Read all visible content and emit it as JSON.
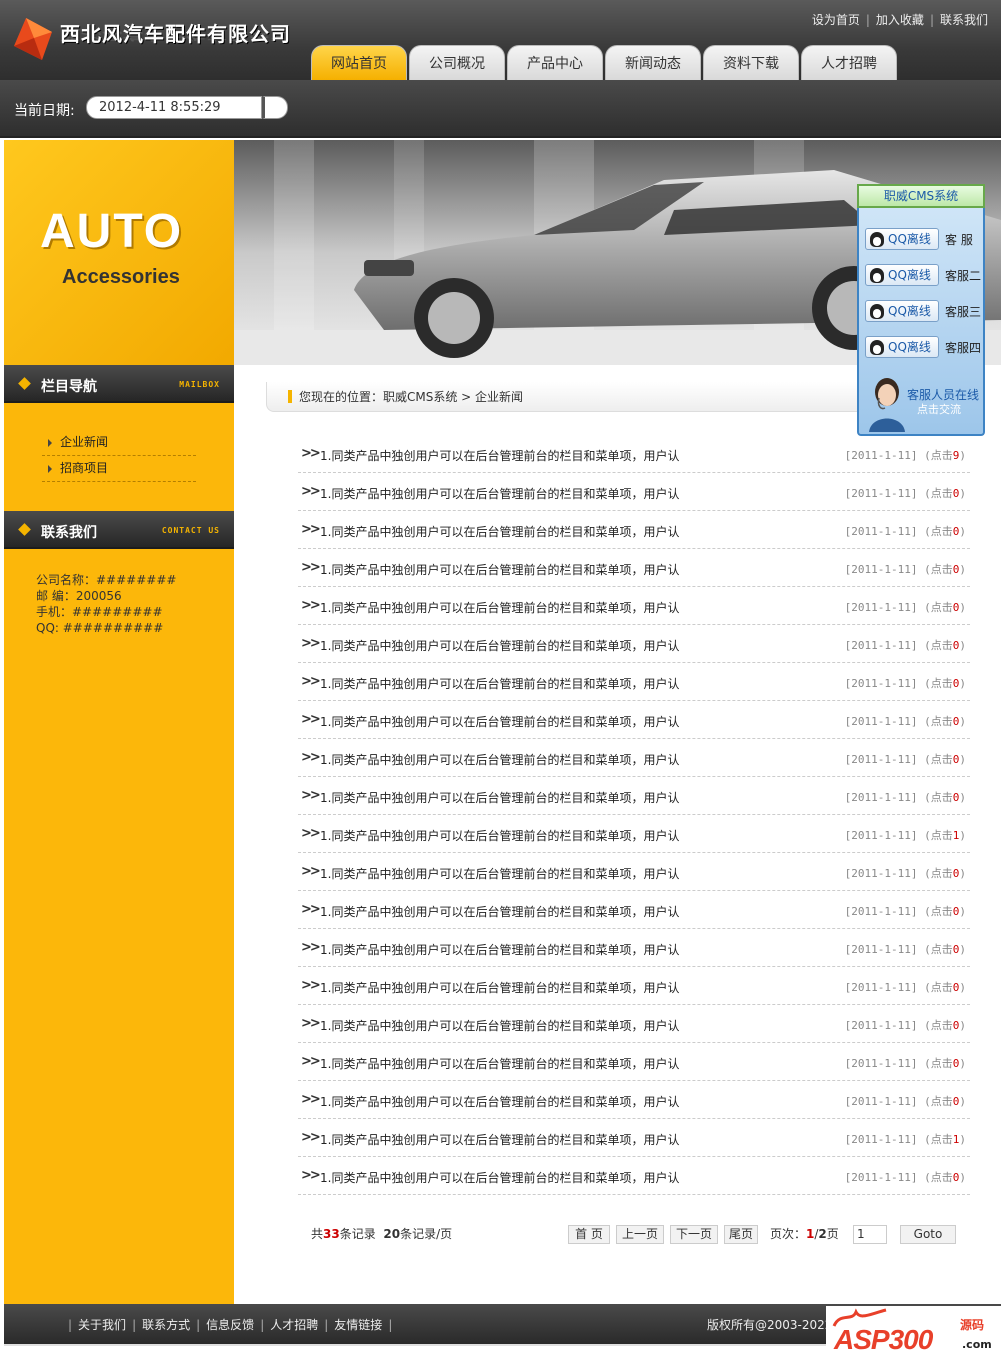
{
  "header": {
    "site_title": "西北风汽车配件有限公司",
    "top_links": [
      "设为首页",
      "加入收藏",
      "联系我们"
    ],
    "nav": [
      {
        "label": "网站首页",
        "active": true
      },
      {
        "label": "公司概况",
        "active": false
      },
      {
        "label": "产品中心",
        "active": false
      },
      {
        "label": "新闻动态",
        "active": false
      },
      {
        "label": "资料下载",
        "active": false
      },
      {
        "label": "人才招聘",
        "active": false
      }
    ]
  },
  "datebar": {
    "label": "当前日期:",
    "value": "2012-4-11 8:55:29"
  },
  "banner": {
    "auto": "AUTO",
    "accessories": "Accessories"
  },
  "sidebar": {
    "nav_title": "栏目导航",
    "nav_sub": "MAILBOX",
    "items": [
      "企业新闻",
      "招商项目"
    ],
    "contact_title": "联系我们",
    "contact_sub": "CONTACT US",
    "contact_lines": [
      "公司名称：########",
      "邮 编：200056",
      "手机：#########",
      "QQ: ##########"
    ]
  },
  "breadcrumb": {
    "text": "您现在的位置：职威CMS系统 > 企业新闻"
  },
  "news": [
    {
      "title": "1.同类产品中独创用户可以在后台管理前台的栏目和菜单项，用户认",
      "date": "2011-1-11",
      "clicks_label": "点击",
      "clicks": "9"
    },
    {
      "title": "1.同类产品中独创用户可以在后台管理前台的栏目和菜单项，用户认",
      "date": "2011-1-11",
      "clicks_label": "点击",
      "clicks": "0"
    },
    {
      "title": "1.同类产品中独创用户可以在后台管理前台的栏目和菜单项，用户认",
      "date": "2011-1-11",
      "clicks_label": "点击",
      "clicks": "0"
    },
    {
      "title": "1.同类产品中独创用户可以在后台管理前台的栏目和菜单项，用户认",
      "date": "2011-1-11",
      "clicks_label": "点击",
      "clicks": "0"
    },
    {
      "title": "1.同类产品中独创用户可以在后台管理前台的栏目和菜单项，用户认",
      "date": "2011-1-11",
      "clicks_label": "点击",
      "clicks": "0"
    },
    {
      "title": "1.同类产品中独创用户可以在后台管理前台的栏目和菜单项，用户认",
      "date": "2011-1-11",
      "clicks_label": "点击",
      "clicks": "0"
    },
    {
      "title": "1.同类产品中独创用户可以在后台管理前台的栏目和菜单项，用户认",
      "date": "2011-1-11",
      "clicks_label": "点击",
      "clicks": "0"
    },
    {
      "title": "1.同类产品中独创用户可以在后台管理前台的栏目和菜单项，用户认",
      "date": "2011-1-11",
      "clicks_label": "点击",
      "clicks": "0"
    },
    {
      "title": "1.同类产品中独创用户可以在后台管理前台的栏目和菜单项，用户认",
      "date": "2011-1-11",
      "clicks_label": "点击",
      "clicks": "0"
    },
    {
      "title": "1.同类产品中独创用户可以在后台管理前台的栏目和菜单项，用户认",
      "date": "2011-1-11",
      "clicks_label": "点击",
      "clicks": "0"
    },
    {
      "title": "1.同类产品中独创用户可以在后台管理前台的栏目和菜单项，用户认",
      "date": "2011-1-11",
      "clicks_label": "点击",
      "clicks": "1"
    },
    {
      "title": "1.同类产品中独创用户可以在后台管理前台的栏目和菜单项，用户认",
      "date": "2011-1-11",
      "clicks_label": "点击",
      "clicks": "0"
    },
    {
      "title": "1.同类产品中独创用户可以在后台管理前台的栏目和菜单项，用户认",
      "date": "2011-1-11",
      "clicks_label": "点击",
      "clicks": "0"
    },
    {
      "title": "1.同类产品中独创用户可以在后台管理前台的栏目和菜单项，用户认",
      "date": "2011-1-11",
      "clicks_label": "点击",
      "clicks": "0"
    },
    {
      "title": "1.同类产品中独创用户可以在后台管理前台的栏目和菜单项，用户认",
      "date": "2011-1-11",
      "clicks_label": "点击",
      "clicks": "0"
    },
    {
      "title": "1.同类产品中独创用户可以在后台管理前台的栏目和菜单项，用户认",
      "date": "2011-1-11",
      "clicks_label": "点击",
      "clicks": "0"
    },
    {
      "title": "1.同类产品中独创用户可以在后台管理前台的栏目和菜单项，用户认",
      "date": "2011-1-11",
      "clicks_label": "点击",
      "clicks": "0"
    },
    {
      "title": "1.同类产品中独创用户可以在后台管理前台的栏目和菜单项，用户认",
      "date": "2011-1-11",
      "clicks_label": "点击",
      "clicks": "0"
    },
    {
      "title": "1.同类产品中独创用户可以在后台管理前台的栏目和菜单项，用户认",
      "date": "2011-1-11",
      "clicks_label": "点击",
      "clicks": "1"
    },
    {
      "title": "1.同类产品中独创用户可以在后台管理前台的栏目和菜单项，用户认",
      "date": "2011-1-11",
      "clicks_label": "点击",
      "clicks": "0"
    }
  ],
  "pager": {
    "total_prefix": "共",
    "total": "33",
    "total_suffix": "条记录",
    "per_page": "20",
    "per_page_suffix": "条记录/页",
    "first": "首 页",
    "prev": "上一页",
    "next": "下一页",
    "last": "尾页",
    "page_label": "页次：",
    "current": "1",
    "total_pages": "2",
    "page_suffix": "页",
    "input_value": "1",
    "goto": "Goto"
  },
  "qq": {
    "title": "职威CMS系统",
    "button_label": "QQ离线",
    "agents": [
      "客 服",
      "客服二",
      "客服三",
      "客服四"
    ],
    "online_line1": "客服人员在线",
    "online_line2": "点击交流"
  },
  "footer": {
    "links": [
      "关于我们",
      "联系方式",
      "信息反馈",
      "人才招聘",
      "友情链接"
    ],
    "copyright": "版权所有@2003-2022"
  },
  "watermark": {
    "brand": "ASP300",
    "sub1": "源码",
    "sub2": ".com"
  },
  "colors": {
    "accent": "#fcb70a",
    "header_dark": "#3a3a3a",
    "clicks_red": "#cc0000"
  }
}
